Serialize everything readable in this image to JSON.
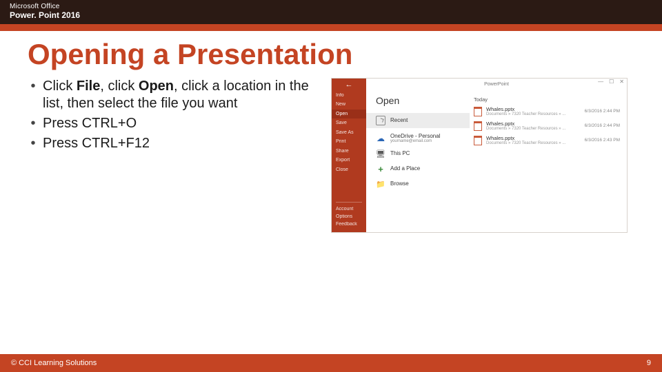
{
  "header": {
    "line1": "Microsoft Office",
    "line2": "Power. Point 2016"
  },
  "title": "Opening a Presentation",
  "bullets": {
    "b1_pre": "Click ",
    "b1_bold1": "File",
    "b1_mid": ", click ",
    "b1_bold2": "Open",
    "b1_post": ", click a location in the list, then select the file you want",
    "b2": "Press CTRL+O",
    "b3": "Press CTRL+F12"
  },
  "shot": {
    "titlebar": "PowerPoint",
    "sidebar": {
      "items": [
        "Info",
        "New",
        "Open",
        "Save",
        "Save As",
        "Print",
        "Share",
        "Export",
        "Close"
      ],
      "bottom": [
        "Account",
        "Options",
        "Feedback"
      ]
    },
    "mid": {
      "heading": "Open",
      "recent": "Recent",
      "onedrive": "OneDrive - Personal",
      "onedrive_sub": "yourname@email.com",
      "thispc": "This PC",
      "addplace": "Add a Place",
      "browse": "Browse"
    },
    "right": {
      "group": "Today",
      "files": [
        {
          "name": "Whales.pptx",
          "path": "Documents » 7320 Teacher Resources » ...",
          "date": "6/3/2016 2:44 PM"
        },
        {
          "name": "Whales.pptx",
          "path": "Documents » 7320 Teacher Resources » ...",
          "date": "6/3/2016 2:44 PM"
        },
        {
          "name": "Whales.pptx",
          "path": "Documents » 7320 Teacher Resources » ...",
          "date": "6/3/2016 2:43 PM"
        }
      ]
    }
  },
  "footer": {
    "copyright": "© CCI Learning Solutions",
    "page": "9"
  }
}
